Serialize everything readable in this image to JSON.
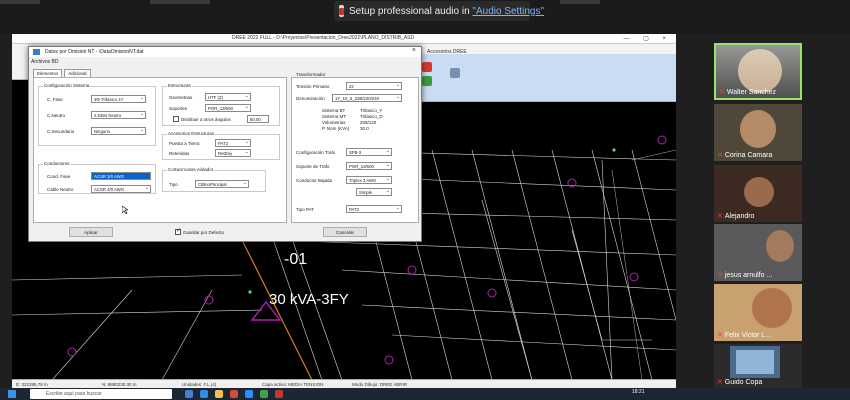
{
  "notification": {
    "text": "Setup professional audio in ",
    "link": "\"Audio Settings\""
  },
  "cad": {
    "title": "DREE 2022 FULL - D:\\Proyectos\\Presentacion_Dree2022\\PLANO_DISTRIB_ASD",
    "menu": "Accesorios DREE",
    "status": [
      "E: 322285.78 m",
      "N: 8880230.30 m",
      "Unidades: F.L.(4)",
      "Capa activa: MEDIA TENSION",
      "Modo Dibujo: DREE ABRIR"
    ],
    "drawing_labels": {
      "id": "-01",
      "kva": "30 kVA-3FY"
    }
  },
  "dialog": {
    "title": "Datos por Omision NT - \\DataOmisionNT.dat",
    "close": "×",
    "menu": "Archivos BD",
    "tabs": [
      "Elementos",
      "Adicional"
    ],
    "sistema": {
      "group": "Configuración Sistema",
      "c_fase_label": "C. Fase",
      "c_fase_value": "3Φ Trifasico 4Y",
      "c_neutro_label": "C.Neutro",
      "c_neutro_value": "2.5384 Neutro",
      "c_secundario_label": "C.Secundario",
      "c_secundario_value": "Ninguno"
    },
    "conductores": {
      "group": "Conductores",
      "cond_fase_label": "Cond. Fase",
      "cond_fase_value": "ACSR 3/0 AWG",
      "cable_neutro_label": "Cable Neutro",
      "cable_neutro_value": "ACSR 4/0 AWG"
    },
    "estructuras": {
      "group": "Estructuras",
      "geometrias_label": "Geometrias",
      "geometrias_value": "HTF (Z)",
      "soportes_label": "Soportes",
      "soportes_value": "POR_13/600",
      "vano_label": "Distribuir a otros ángulos",
      "vano_value": "50.00"
    },
    "accesorios": {
      "group": "Accesorios Estructuras",
      "puesta_label": "Puesta a Tierra",
      "puesta_value": "PAT2",
      "retenidas_label": "Retenidas",
      "retenidas_value": "RetDoy"
    },
    "cortacircuitos": {
      "group": "Cortacircuitos-Aislador",
      "tipo_label": "Tipo",
      "tipo_value": "CBtnoPrincipal"
    },
    "transformador": {
      "group": "Transformador",
      "tension_label": "Tensión Primario",
      "tension_value": "22",
      "denominacion_label": "Denominación",
      "denominacion_value": "1Y_10_5_22B/220/230",
      "info": [
        {
          "label": "Sistema BT",
          "value": "Trifasico_Y"
        },
        {
          "label": "Sistema MT",
          "value": "Trifasico_D"
        },
        {
          "label": "Volumetrias",
          "value": "208/120"
        },
        {
          "label": "P. Nom (KVA)",
          "value": "30.0"
        }
      ],
      "config_trafo_label": "Configuración Trafo",
      "config_trafo_value": "SFB-3",
      "soporte_label": "Soporte de Trafo",
      "soporte_value": "POR_13/600",
      "bajada_label": "Conductor Bajada",
      "bajada_value": "Triplex 3 AWG",
      "bajada_value2": "Simple",
      "pat_label": "Tipo PAT",
      "pat_value": "PAT2"
    },
    "guardar_label": "Guardar por Defecto",
    "aplicar_label": "Aplicar",
    "cancelar_label": "Cancelar"
  },
  "participants": [
    {
      "name": "Walter Sanchez",
      "active": true
    },
    {
      "name": "Corina Camara",
      "active": false
    },
    {
      "name": "Alejandro",
      "active": false
    },
    {
      "name": "jesus arnulfo ...",
      "active": false
    },
    {
      "name": "Felix Victor L...",
      "active": false
    },
    {
      "name": "Guido Copa",
      "active": false
    }
  ],
  "taskbar": {
    "search_placeholder": "Escribe aquí para buscar",
    "clock": "18:21"
  }
}
